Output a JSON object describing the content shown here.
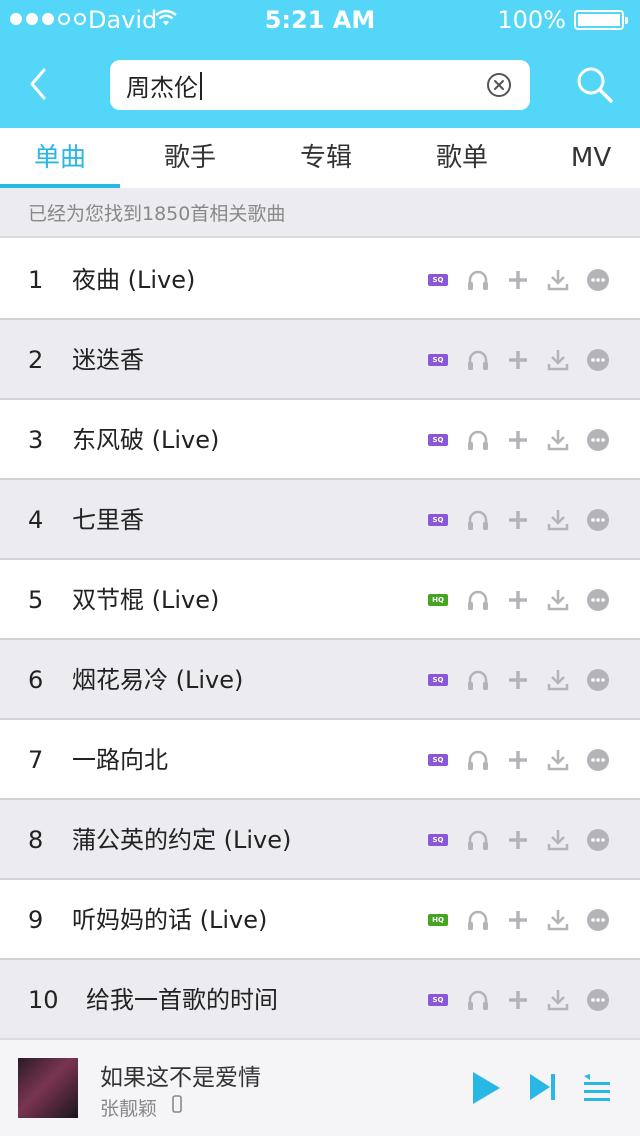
{
  "status_bar": {
    "carrier": "David",
    "time": "5:21 AM",
    "battery": "100%"
  },
  "search": {
    "query": "周杰伦"
  },
  "tabs": [
    {
      "label": "单曲",
      "active": true
    },
    {
      "label": "歌手",
      "active": false
    },
    {
      "label": "专辑",
      "active": false
    },
    {
      "label": "歌单",
      "active": false
    },
    {
      "label": "MV",
      "active": false
    }
  ],
  "result_summary": "已经为您找到1850首相关歌曲",
  "songs": [
    {
      "num": "1",
      "title": "夜曲 (Live)",
      "quality": "SQ"
    },
    {
      "num": "2",
      "title": "迷迭香",
      "quality": "SQ"
    },
    {
      "num": "3",
      "title": "东风破 (Live)",
      "quality": "SQ"
    },
    {
      "num": "4",
      "title": "七里香",
      "quality": "SQ"
    },
    {
      "num": "5",
      "title": "双节棍 (Live)",
      "quality": "HQ"
    },
    {
      "num": "6",
      "title": "烟花易冷 (Live)",
      "quality": "SQ"
    },
    {
      "num": "7",
      "title": "一路向北",
      "quality": "SQ"
    },
    {
      "num": "8",
      "title": "蒲公英的约定 (Live)",
      "quality": "SQ"
    },
    {
      "num": "9",
      "title": "听妈妈的话 (Live)",
      "quality": "HQ"
    },
    {
      "num": "10",
      "title": "给我一首歌的时间",
      "quality": "SQ"
    }
  ],
  "now_playing": {
    "title": "如果这不是爱情",
    "artist": "张靓颖"
  },
  "colors": {
    "header": "#54d6f8",
    "accent": "#29b7e6",
    "sq_badge": "#8a57d8",
    "hq_badge": "#45a521"
  },
  "icons": [
    "back-icon",
    "clear-icon",
    "search-icon",
    "headphones-icon",
    "add-icon",
    "download-icon",
    "more-icon",
    "play-icon",
    "next-icon",
    "queue-icon"
  ]
}
